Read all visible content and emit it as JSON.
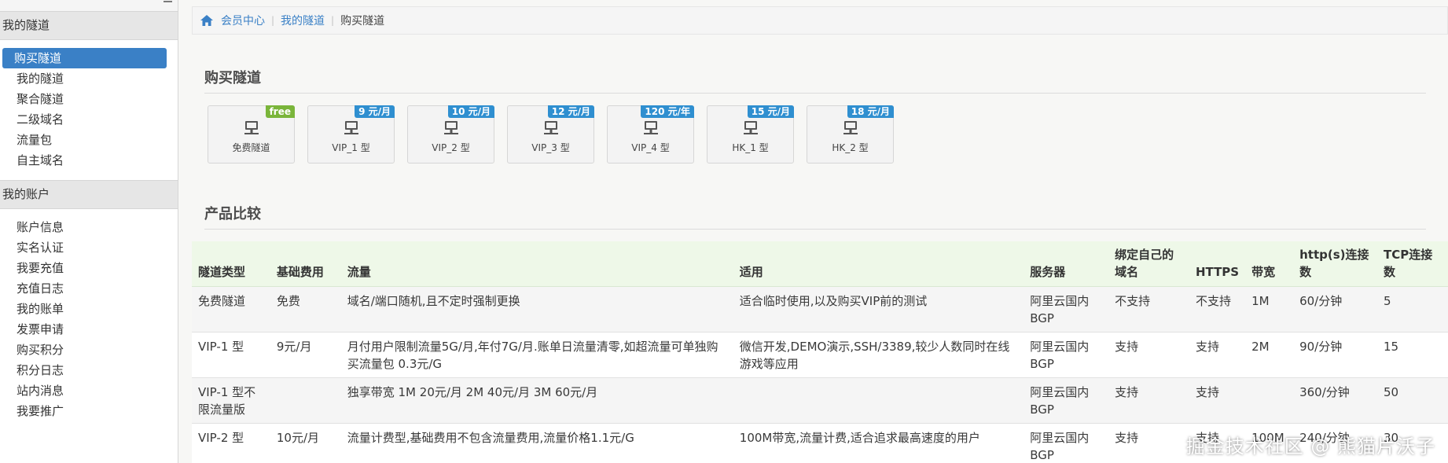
{
  "sidebar": {
    "sections": [
      {
        "title": "我的隧道",
        "items": [
          {
            "label": "购买隧道",
            "active": true
          },
          {
            "label": "我的隧道"
          },
          {
            "label": "聚合隧道"
          },
          {
            "label": "二级域名"
          },
          {
            "label": "流量包"
          },
          {
            "label": "自主域名"
          }
        ]
      },
      {
        "title": "我的账户",
        "items": [
          {
            "label": "账户信息"
          },
          {
            "label": "实名认证"
          },
          {
            "label": "我要充值"
          },
          {
            "label": "充值日志"
          },
          {
            "label": "我的账单"
          },
          {
            "label": "发票申请"
          },
          {
            "label": "购买积分"
          },
          {
            "label": "积分日志"
          },
          {
            "label": "站内消息"
          },
          {
            "label": "我要推广"
          }
        ]
      }
    ]
  },
  "breadcrumb": {
    "items": [
      "会员中心",
      "我的隧道"
    ],
    "current": "购买隧道"
  },
  "buy_section": {
    "title": "购买隧道",
    "products": [
      {
        "label": "免费隧道",
        "tag": "free",
        "tag_type": "free"
      },
      {
        "label": "VIP_1 型",
        "tag": "9 元/月"
      },
      {
        "label": "VIP_2 型",
        "tag": "10 元/月"
      },
      {
        "label": "VIP_3 型",
        "tag": "12 元/月"
      },
      {
        "label": "VIP_4 型",
        "tag": "120 元/年"
      },
      {
        "label": "HK_1 型",
        "tag": "15 元/月"
      },
      {
        "label": "HK_2 型",
        "tag": "18 元/月"
      }
    ]
  },
  "compare_section": {
    "title": "产品比较",
    "columns": [
      "隧道类型",
      "基础费用",
      "流量",
      "适用",
      "服务器",
      "绑定自己的域名",
      "HTTPS",
      "带宽",
      "http(s)连接数",
      "TCP连接数"
    ],
    "rows": [
      [
        "免费隧道",
        "免费",
        "域名/端口随机,且不定时强制更换",
        "适合临时使用,以及购买VIP前的测试",
        "阿里云国内BGP",
        "不支持",
        "不支持",
        "1M",
        "60/分钟",
        "5"
      ],
      [
        "VIP-1 型",
        "9元/月",
        "月付用户限制流量5G/月,年付7G/月.账单日流量清零,如超流量可单独购买流量包 0.3元/G",
        "微信开发,DEMO演示,SSH/3389,较少人数同时在线游戏等应用",
        "阿里云国内BGP",
        "支持",
        "支持",
        "2M",
        "90/分钟",
        "15"
      ],
      [
        "VIP-1 型不限流量版",
        "",
        "独享带宽 1M 20元/月 2M 40元/月 3M 60元/月",
        "",
        "阿里云国内BGP",
        "支持",
        "支持",
        "",
        "360/分钟",
        "50"
      ],
      [
        "VIP-2 型",
        "10元/月",
        "流量计费型,基础费用不包含流量费用,流量价格1.1元/G",
        "100M带宽,流量计费,适合追求最高速度的用户",
        "阿里云国内BGP",
        "支持",
        "支持",
        "100M",
        "240/分钟",
        "30"
      ]
    ]
  },
  "watermark": "掘金技术社区 @ 熊猫片沃子",
  "colors": {
    "accent": "#3a80c6",
    "tag_blue": "#2f8fd0",
    "tag_free": "#7ab53a",
    "table_header_bg": "#eef8e8"
  }
}
